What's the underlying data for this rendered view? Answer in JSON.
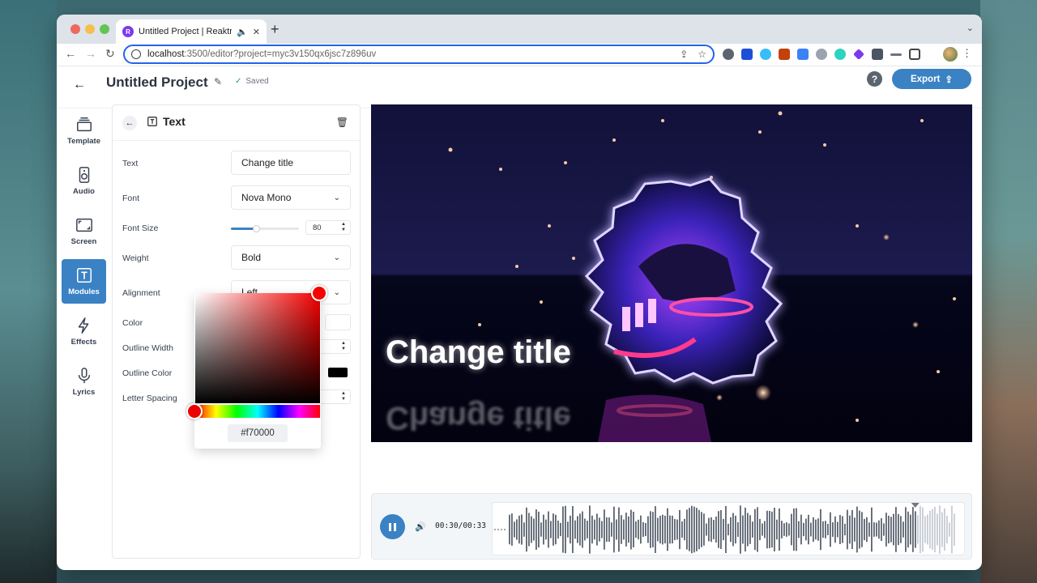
{
  "browser": {
    "tab_title": "Untitled Project | Reaktr",
    "tab_favicon": "R",
    "url_host": "localhost",
    "url_path": ":3500/editor?project=myc3v150qx6jsc7z896uv"
  },
  "header": {
    "title": "Untitled Project",
    "saved_label": "Saved",
    "help_label": "?",
    "export_label": "Export"
  },
  "sidebar": {
    "items": [
      {
        "label": "Template",
        "icon": "layers-icon"
      },
      {
        "label": "Audio",
        "icon": "speaker-icon"
      },
      {
        "label": "Screen",
        "icon": "screen-icon"
      },
      {
        "label": "Modules",
        "icon": "modules-icon",
        "active": true
      },
      {
        "label": "Effects",
        "icon": "lightning-icon"
      },
      {
        "label": "Lyrics",
        "icon": "microphone-icon"
      }
    ]
  },
  "panel": {
    "title": "Text",
    "fields": {
      "text_label": "Text",
      "text_value": "Change title",
      "font_label": "Font",
      "font_value": "Nova Mono",
      "font_size_label": "Font Size",
      "font_size_value": "80",
      "font_size_fraction": 0.37,
      "weight_label": "Weight",
      "weight_value": "Bold",
      "alignment_label": "Alignment",
      "alignment_value": "Left",
      "color_label": "Color",
      "outline_width_label": "Outline Width",
      "outline_color_label": "Outline Color",
      "letter_spacing_label": "Letter Spacing"
    },
    "color_picker": {
      "hex": "#f70000"
    }
  },
  "preview": {
    "title_text": "Change title"
  },
  "player": {
    "time": "00:30/00:33",
    "progress_fraction": 0.909
  },
  "colors": {
    "accent": "#3b82c4",
    "selected_color": "#f70000",
    "outline_color": "#000000"
  }
}
